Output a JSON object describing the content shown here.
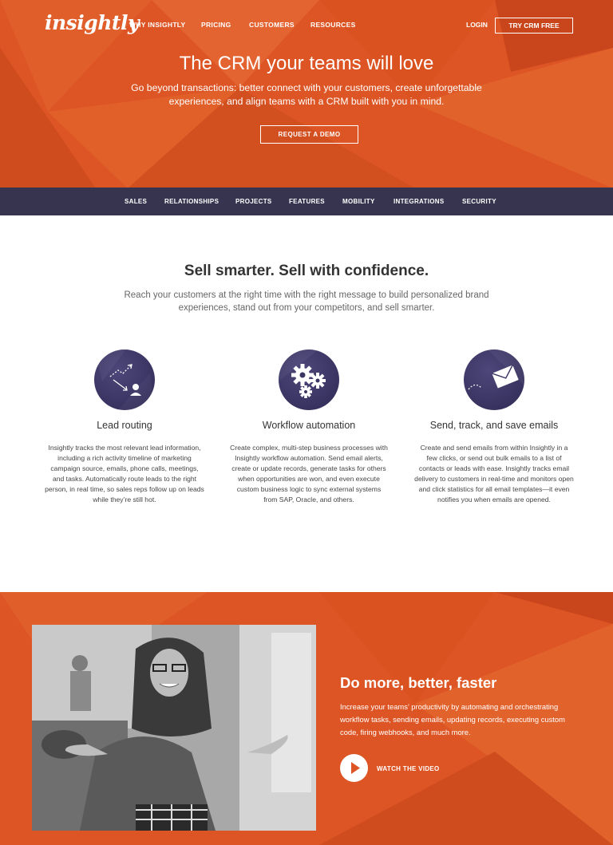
{
  "brand": {
    "logo_text": "insightly"
  },
  "top_nav": {
    "items": [
      "WHY INSIGHTLY",
      "PRICING",
      "CUSTOMERS",
      "RESOURCES"
    ],
    "login": "LOGIN",
    "cta": "TRY CRM FREE"
  },
  "hero": {
    "title": "The CRM your teams will love",
    "subtitle": "Go beyond transactions: better connect with your customers, create unforgettable experiences, and align teams with a CRM built with you in mind.",
    "button": "REQUEST A DEMO"
  },
  "subnav": {
    "items": [
      "SALES",
      "RELATIONSHIPS",
      "PROJECTS",
      "FEATURES",
      "MOBILITY",
      "INTEGRATIONS",
      "SECURITY"
    ]
  },
  "sell": {
    "title": "Sell smarter. Sell with confidence.",
    "subtitle": "Reach your customers at the right time with the right message to build personalized brand experiences, stand out from your competitors, and sell smarter.",
    "features": [
      {
        "icon": "lead-routing-icon",
        "title": "Lead routing",
        "text": "Insightly tracks the most relevant lead information, including a rich activity timeline of marketing campaign source, emails, phone calls, meetings, and tasks. Automatically route leads to the right person, in real time, so sales reps follow up on leads while they’re still hot."
      },
      {
        "icon": "gears-icon",
        "title": "Workflow automation",
        "text": "Create complex, multi-step business processes with Insightly workflow automation. Send email alerts, create or update records, generate tasks for others when opportunities are won, and even execute custom business logic to sync external systems from SAP, Oracle, and others."
      },
      {
        "icon": "envelope-icon",
        "title": "Send, track, and save emails",
        "text": "Create and send emails from within Insightly in a few clicks, or send out bulk emails to a list of contacts or leads with ease. Insightly tracks email delivery to customers in real-time and monitors open and click statistics for all email templates—it even notifies you when emails are opened."
      }
    ]
  },
  "video": {
    "title": "Do more, better, faster",
    "text": "Increase your teams’ productivity by automating and orchestrating workflow tasks, sending emails, updating records, executing custom code, firing webhooks, and much more.",
    "link": "WATCH THE VIDEO"
  },
  "colors": {
    "orange": "#dd5524",
    "navy": "#37344f",
    "icon_purple": "#3a3563"
  }
}
